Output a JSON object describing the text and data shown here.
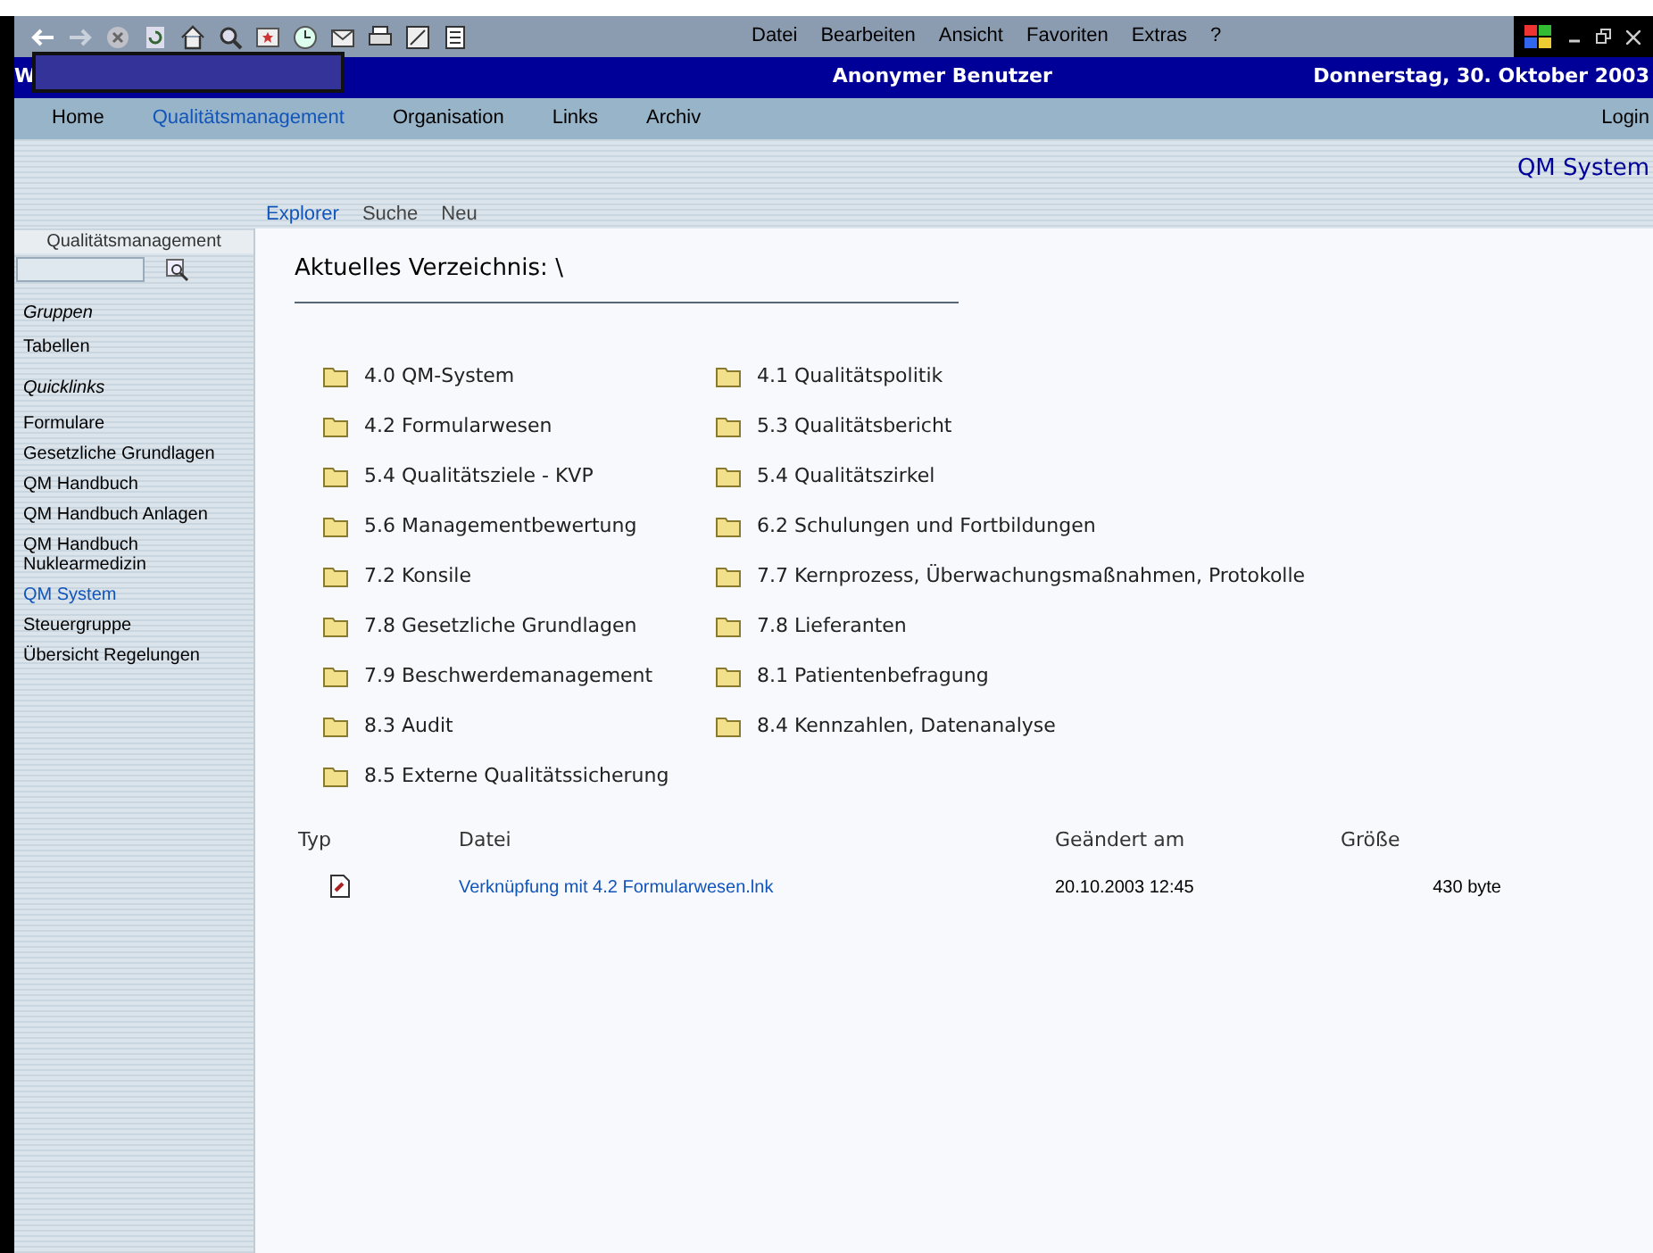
{
  "browser_menu": [
    "Datei",
    "Bearbeiten",
    "Ansicht",
    "Favoriten",
    "Extras",
    "?"
  ],
  "header": {
    "site_letter": "W",
    "user": "Anonymer Benutzer",
    "date": "Donnerstag, 30. Oktober 2003"
  },
  "nav": [
    {
      "label": "Home",
      "selected": false
    },
    {
      "label": "Qualitätsmanagement",
      "selected": true
    },
    {
      "label": "Organisation",
      "selected": false
    },
    {
      "label": "Links",
      "selected": false
    },
    {
      "label": "Archiv",
      "selected": false
    }
  ],
  "login": "Login",
  "section_title": "QM System",
  "subnav": [
    {
      "label": "Explorer",
      "selected": true
    },
    {
      "label": "Suche",
      "selected": false
    },
    {
      "label": "Neu",
      "selected": false
    }
  ],
  "sidebar": {
    "title": "Qualitätsmanagement",
    "groups": [
      {
        "heading": "Gruppen",
        "items": [
          {
            "label": "Tabellen",
            "selected": false
          }
        ]
      },
      {
        "heading": "Quicklinks",
        "items": [
          {
            "label": "Formulare",
            "selected": false
          },
          {
            "label": "Gesetzliche Grundlagen",
            "selected": false
          },
          {
            "label": "QM Handbuch",
            "selected": false
          },
          {
            "label": "QM Handbuch Anlagen",
            "selected": false
          },
          {
            "label": "QM Handbuch Nuklearmedizin",
            "selected": false
          },
          {
            "label": "QM System",
            "selected": true
          },
          {
            "label": "Steuergruppe",
            "selected": false
          },
          {
            "label": "Übersicht Regelungen",
            "selected": false
          }
        ]
      }
    ]
  },
  "current_dir": "Aktuelles Verzeichnis: \\",
  "folders": [
    "4.0 QM-System",
    "4.1 Qualitätspolitik",
    "4.2 Formularwesen",
    "5.3 Qualitätsbericht",
    "5.4 Qualitätsziele - KVP",
    "5.4 Qualitätszirkel",
    "5.6 Managementbewertung",
    "6.2 Schulungen und Fortbildungen",
    "7.2 Konsile",
    "7.7 Kernprozess, Überwachungsmaßnahmen, Protokolle",
    "7.8 Gesetzliche Grundlagen",
    "7.8 Lieferanten",
    "7.9 Beschwerdemanagement",
    "8.1 Patientenbefragung",
    "8.3 Audit",
    "8.4 Kennzahlen, Datenanalyse",
    "8.5 Externe Qualitätssicherung"
  ],
  "files": {
    "columns": [
      "Typ",
      "Datei",
      "Geändert am",
      "Größe"
    ],
    "rows": [
      {
        "name": "Verknüpfung mit 4.2 Formularwesen.lnk",
        "modified": "20.10.2003 12:45",
        "size": "430 byte"
      }
    ]
  }
}
